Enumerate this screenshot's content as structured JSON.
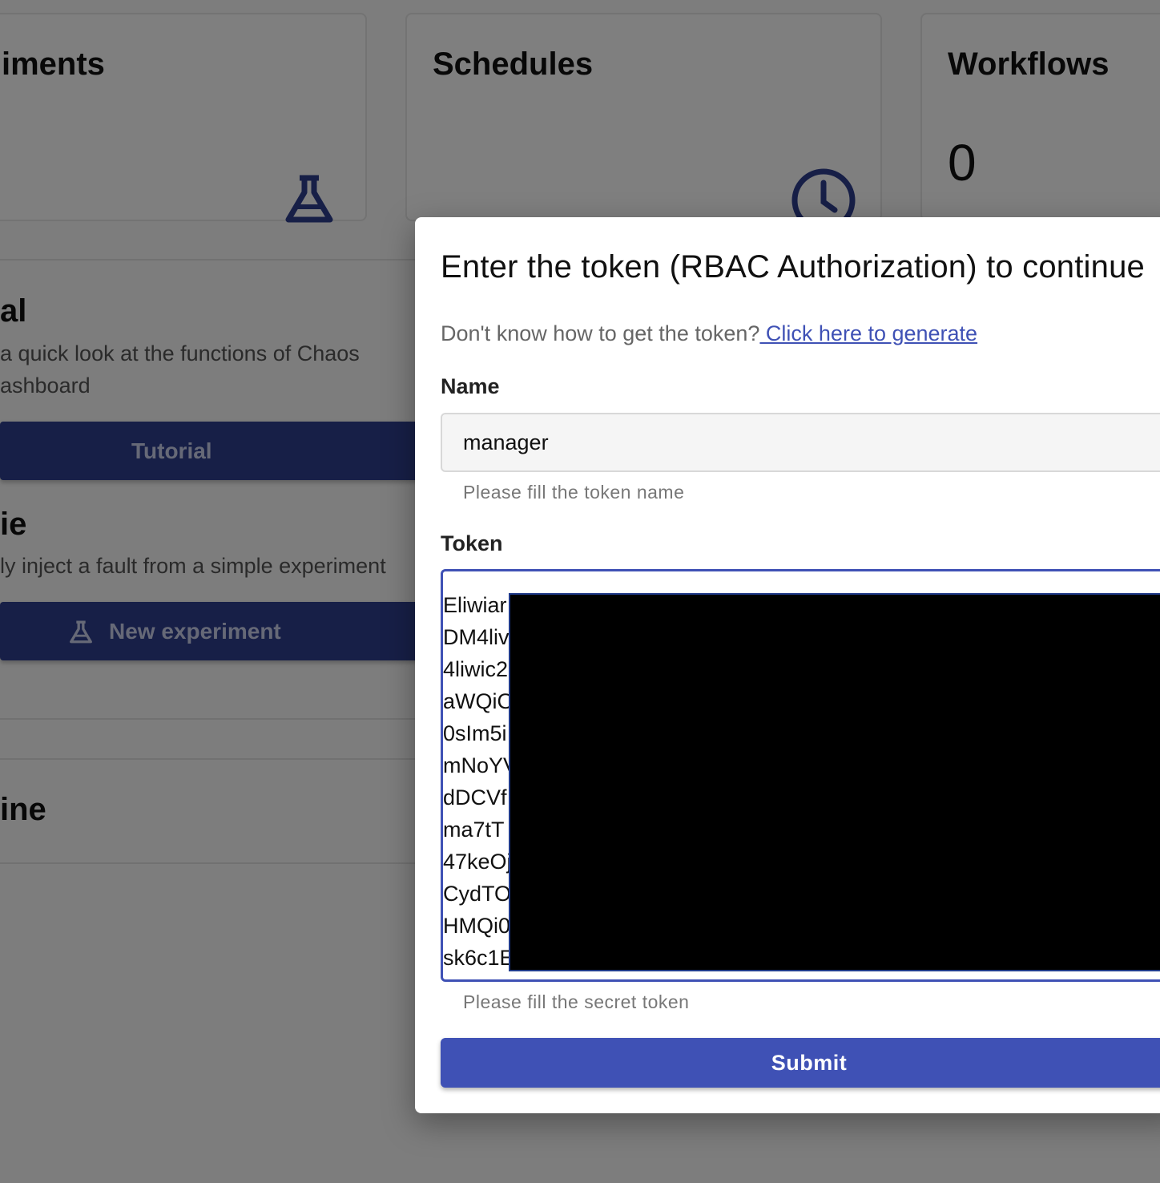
{
  "background": {
    "cards": {
      "experiments": {
        "title": "iments",
        "icon": "flask-icon"
      },
      "schedules": {
        "title": "Schedules",
        "icon": "clock-icon"
      },
      "workflows": {
        "title": "Workflows",
        "count": "0"
      }
    },
    "tutorial": {
      "title": "al",
      "desc_line1": "a quick look at the functions of Chaos",
      "desc_line2": "ashboard",
      "button_label": "Tutorial"
    },
    "newbie": {
      "title": "ie",
      "desc": "ly inject a fault from a simple experiment",
      "button_label": "New experiment",
      "button_icon": "flask-icon"
    },
    "timeline": {
      "title": "ine"
    }
  },
  "dialog": {
    "title": "Enter the token (RBAC Authorization) to continue",
    "help_text": "Don't know how to get the token?",
    "help_link": " Click here to generate",
    "name_label": "Name",
    "name_value": "manager",
    "name_helper": "Please fill the token name",
    "token_label": "Token",
    "token_lines": [
      "Eliwiar",
      "DM4liv",
      "4liwic2",
      "aWQiO",
      "0sIm5i",
      "mNoYV",
      "dDCVf",
      "ma7tT",
      "47keOj",
      "CydTO",
      "HMQi0",
      "sk6c1E"
    ],
    "token_helper": "Please fill the secret token",
    "submit_label": "Submit"
  },
  "colors": {
    "primary": "#3f51b5",
    "primary_dark": "#2f3e8f",
    "overlay": "rgba(0,0,0,0.5)",
    "redaction": "#000000"
  }
}
